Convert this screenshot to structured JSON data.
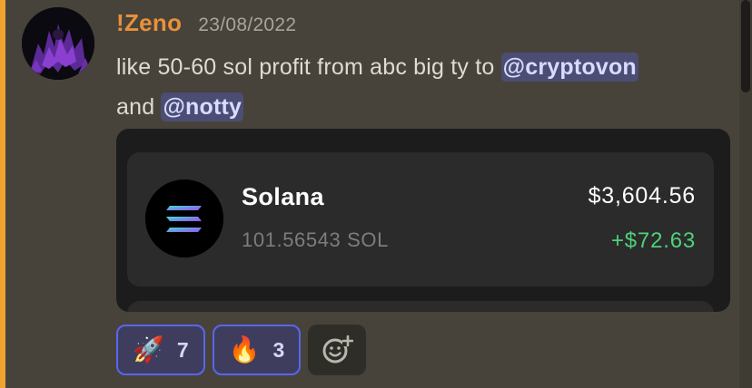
{
  "message": {
    "username": "!Zeno",
    "timestamp": "23/08/2022",
    "text_part1": "like 50-60 sol profit from abc big ty to ",
    "mention1": "@cryptovon",
    "text_part2": "and ",
    "mention2": "@notty",
    "accent_color": "#f0a330",
    "username_color": "#e8913a"
  },
  "embed": {
    "token": {
      "name": "Solana",
      "amount": "101.56543 SOL",
      "value": "$3,604.56",
      "change": "+$72.63",
      "icon": "solana-logo",
      "change_color": "#4fd17a"
    }
  },
  "reactions": [
    {
      "emoji": "🚀",
      "icon": "rocket-emoji",
      "count": "7"
    },
    {
      "emoji": "🔥",
      "icon": "fire-emoji",
      "count": "3"
    }
  ],
  "add_reaction_icon": "add-reaction-icon"
}
